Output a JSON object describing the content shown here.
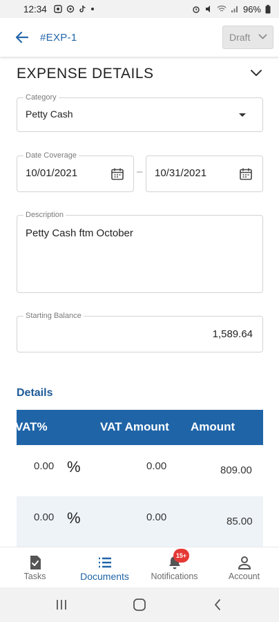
{
  "status_bar": {
    "time": "12:34",
    "battery": "96%"
  },
  "header": {
    "document_id": "#EXP-1",
    "status_value": "Draft"
  },
  "section": {
    "title": "EXPENSE DETAILS"
  },
  "form": {
    "category": {
      "label": "Category",
      "value": "Petty Cash"
    },
    "date_coverage": {
      "label": "Date Coverage",
      "start": "10/01/2021",
      "separator": "–",
      "end": "10/31/2021"
    },
    "description": {
      "label": "Description",
      "value": "Petty Cash ftm October"
    },
    "starting_balance": {
      "label": "Starting Balance",
      "value": "1,589.64"
    }
  },
  "details": {
    "title": "Details",
    "columns": [
      "VAT%",
      "VAT Amount",
      "Amount"
    ],
    "rows": [
      {
        "vat_pct": "0.00",
        "pct_symbol": "%",
        "vat_amount": "0.00",
        "amount": "809.00"
      },
      {
        "vat_pct": "0.00",
        "pct_symbol": "%",
        "vat_amount": "0.00",
        "amount": "85.00"
      }
    ]
  },
  "bottom_nav": {
    "items": [
      {
        "label": "Tasks",
        "icon": "tasks-icon"
      },
      {
        "label": "Documents",
        "icon": "list-icon"
      },
      {
        "label": "Notifications",
        "icon": "bell-icon"
      },
      {
        "label": "Account",
        "icon": "person-icon"
      }
    ],
    "active_index": 1,
    "notifications_badge": "15+"
  },
  "colors": {
    "accent": "#1f64a7",
    "link": "#2467a8",
    "table_header": "#1f64a7",
    "row_alt": "#eef3f8",
    "badge": "#e53935"
  }
}
